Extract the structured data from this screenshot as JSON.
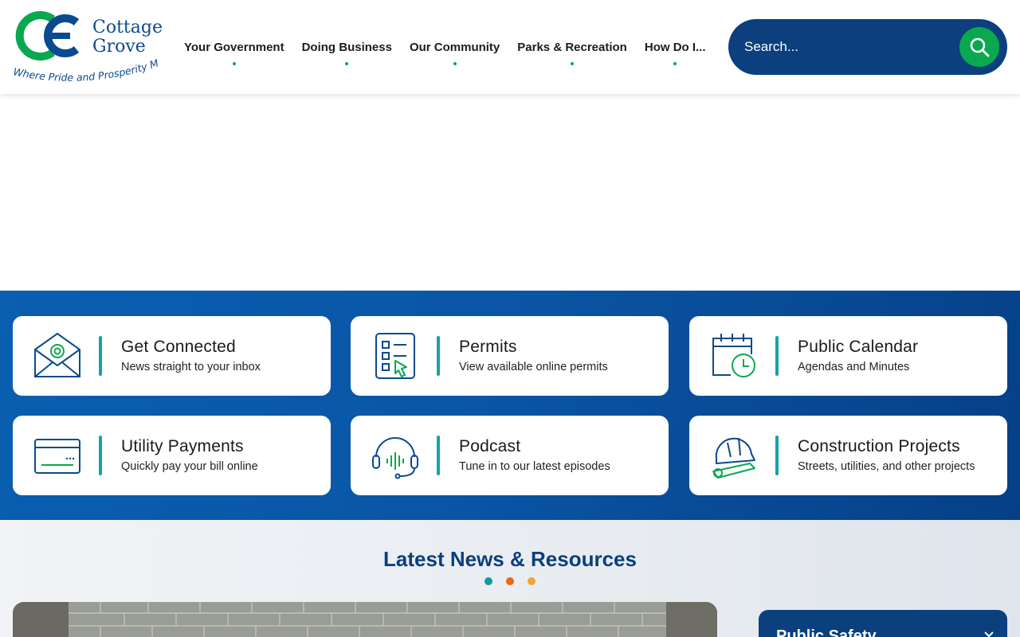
{
  "brand": {
    "name_line1": "Cottage",
    "name_line2": "Grove",
    "tagline": "Where Pride and Prosperity Meet",
    "colors": {
      "blue": "#0b4a8f",
      "green": "#0aa84f"
    }
  },
  "nav": {
    "items": [
      {
        "label": "Your Government"
      },
      {
        "label": "Doing Business"
      },
      {
        "label": "Our Community"
      },
      {
        "label": "Parks & Recreation"
      },
      {
        "label": "How Do I..."
      }
    ]
  },
  "search": {
    "placeholder": "Search...",
    "icon": "search-icon"
  },
  "quick_links": [
    {
      "title": "Get Connected",
      "desc": "News straight to your inbox",
      "icon": "email-envelope-icon"
    },
    {
      "title": "Permits",
      "desc": "View available online permits",
      "icon": "checklist-icon"
    },
    {
      "title": "Public Calendar",
      "desc": "Agendas and Minutes",
      "icon": "calendar-clock-icon"
    },
    {
      "title": "Utility Payments",
      "desc": "Quickly pay your bill online",
      "icon": "credit-card-icon"
    },
    {
      "title": "Podcast",
      "desc": "Tune in to our latest episodes",
      "icon": "headphones-icon"
    },
    {
      "title": "Construction Projects",
      "desc": "Streets, utilities, and other projects",
      "icon": "hard-hat-icon"
    }
  ],
  "news": {
    "title": "Latest News & Resources",
    "dot_colors": [
      "#1597a3",
      "#e86a1a",
      "#f2a531"
    ]
  },
  "sidebar": {
    "panel_label": "Public Safety"
  }
}
